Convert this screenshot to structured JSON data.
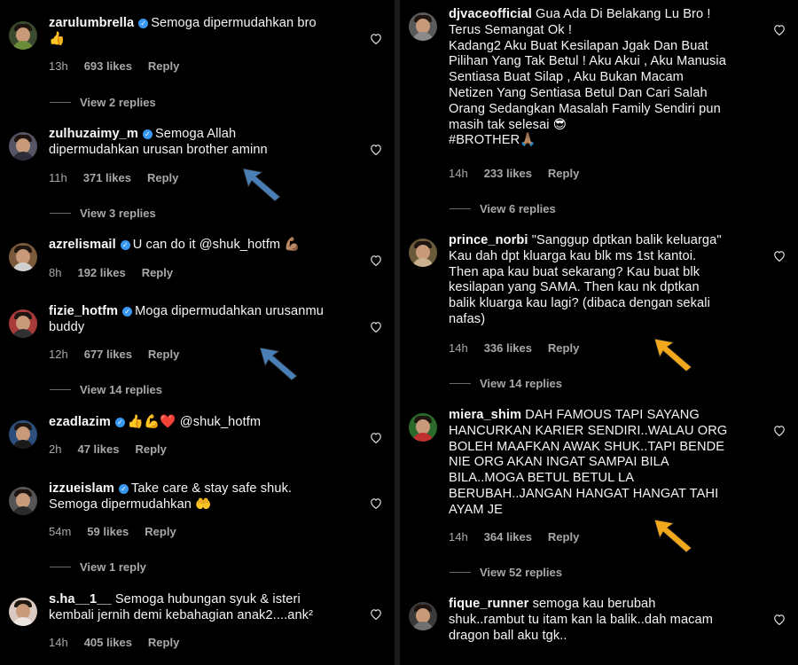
{
  "left": {
    "comments": [
      {
        "username": "zarulumbrella",
        "verified": true,
        "text": "Semoga dipermudahkan bro\n👍",
        "time": "13h",
        "likes": "693 likes",
        "reply": "Reply",
        "view_replies": "View 2 replies"
      },
      {
        "username": "zulhuzaimy_m",
        "verified": true,
        "text": "Semoga Allah\ndipermudahkan urusan brother aminn",
        "time": "11h",
        "likes": "371 likes",
        "reply": "Reply",
        "view_replies": "View 3 replies"
      },
      {
        "username": "azrelismail",
        "verified": true,
        "text": "U can do it @shuk_hotfm 💪🏽",
        "time": "8h",
        "likes": "192 likes",
        "reply": "Reply",
        "view_replies": ""
      },
      {
        "username": "fizie_hotfm",
        "verified": true,
        "text": "Moga dipermudahkan urusanmu\nbuddy",
        "time": "12h",
        "likes": "677 likes",
        "reply": "Reply",
        "view_replies": "View 14 replies"
      },
      {
        "username": "ezadlazim",
        "verified": true,
        "text": "👍💪❤️ @shuk_hotfm",
        "time": "2h",
        "likes": "47 likes",
        "reply": "Reply",
        "view_replies": ""
      },
      {
        "username": "izzueislam",
        "verified": true,
        "text": "Take care & stay safe shuk.\nSemoga dipermudahkan 🤲",
        "time": "54m",
        "likes": "59 likes",
        "reply": "Reply",
        "view_replies": "View 1 reply"
      },
      {
        "username": "s.ha__1__",
        "verified": false,
        "text": "Semoga hubungan syuk & isteri\nkembali jernih demi kebahagian anak2....ank²",
        "time": "14h",
        "likes": "405 likes",
        "reply": "Reply",
        "view_replies": ""
      }
    ]
  },
  "right": {
    "comments": [
      {
        "username": "djvaceofficial",
        "verified": false,
        "text": "Gua Ada Di Belakang Lu Bro !\nTerus Semangat Ok !\nKadang2 Aku Buat Kesilapan Jgak Dan Buat\nPilihan Yang Tak Betul ! Aku Akui , Aku Manusia\nSentiasa Buat Silap , Aku Bukan Macam\nNetizen Yang Sentiasa Betul Dan Cari Salah\nOrang Sedangkan Masalah Family Sendiri pun\nmasih tak selesai 😎\n#BROTHER🙏🏽",
        "time": "14h",
        "likes": "233 likes",
        "reply": "Reply",
        "view_replies": "View 6 replies"
      },
      {
        "username": "prince_norbi",
        "verified": false,
        "text": "\"Sanggup dptkan balik keluarga\"\nKau dah dpt kluarga kau blk ms 1st kantoi.\nThen apa kau buat sekarang? Kau buat blk\nkesilapan yang SAMA. Then kau nk dptkan\nbalik kluarga kau lagi? (dibaca dengan sekali\nnafas)",
        "time": "14h",
        "likes": "336 likes",
        "reply": "Reply",
        "view_replies": "View 14 replies"
      },
      {
        "username": "miera_shim",
        "verified": false,
        "text": "DAH FAMOUS TAPI SAYANG\nHANCURKAN KARIER SENDIRI..WALAU ORG\nBOLEH MAAFKAN AWAK SHUK..TAPI BENDE\nNIE ORG AKAN INGAT SAMPAI BILA\nBILA..MOGA BETUL BETUL LA\nBERUBAH..JANGAN HANGAT HANGAT TAHI\nAYAM JE",
        "time": "14h",
        "likes": "364 likes",
        "reply": "Reply",
        "view_replies": "View 52 replies"
      },
      {
        "username": "fique_runner",
        "verified": false,
        "text": "semoga kau berubah\nshuk..rambut tu itam kan la balik..dah macam\ndragon ball aku tgk..",
        "time": "",
        "likes": "",
        "reply": "",
        "view_replies": ""
      }
    ]
  },
  "colors": {
    "background": "#000000",
    "text": "#f5f5f5",
    "muted": "#a8a8a8",
    "verified": "#3897f0",
    "arrow_blue": "#4a7fb5",
    "arrow_orange": "#f2a81d"
  },
  "icons": {
    "like": "heart-outline-icon",
    "verified": "verified-badge-icon",
    "arrow": "pointer-arrow-icon"
  }
}
